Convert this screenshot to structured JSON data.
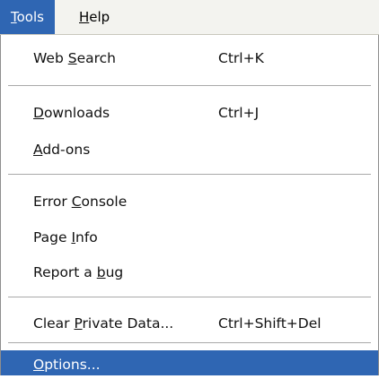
{
  "menubar": {
    "items": [
      {
        "pre": "",
        "mn": "T",
        "post": "ools"
      },
      {
        "pre": "",
        "mn": "H",
        "post": "elp"
      }
    ]
  },
  "menu": {
    "groups": [
      [
        {
          "pre": "Web ",
          "mn": "S",
          "post": "earch",
          "shortcut": "Ctrl+K"
        }
      ],
      [
        {
          "pre": "",
          "mn": "D",
          "post": "ownloads",
          "shortcut": "Ctrl+J"
        },
        {
          "pre": "",
          "mn": "A",
          "post": "dd-ons",
          "shortcut": ""
        }
      ],
      [
        {
          "pre": "Error ",
          "mn": "C",
          "post": "onsole",
          "shortcut": ""
        },
        {
          "pre": "Page ",
          "mn": "I",
          "post": "nfo",
          "shortcut": ""
        },
        {
          "pre": "Report a ",
          "mn": "b",
          "post": "ug",
          "shortcut": ""
        }
      ],
      [
        {
          "pre": "Clear ",
          "mn": "P",
          "post": "rivate Data...",
          "shortcut": "Ctrl+Shift+Del"
        }
      ],
      [
        {
          "pre": "",
          "mn": "O",
          "post": "ptions...",
          "shortcut": ""
        }
      ]
    ]
  }
}
